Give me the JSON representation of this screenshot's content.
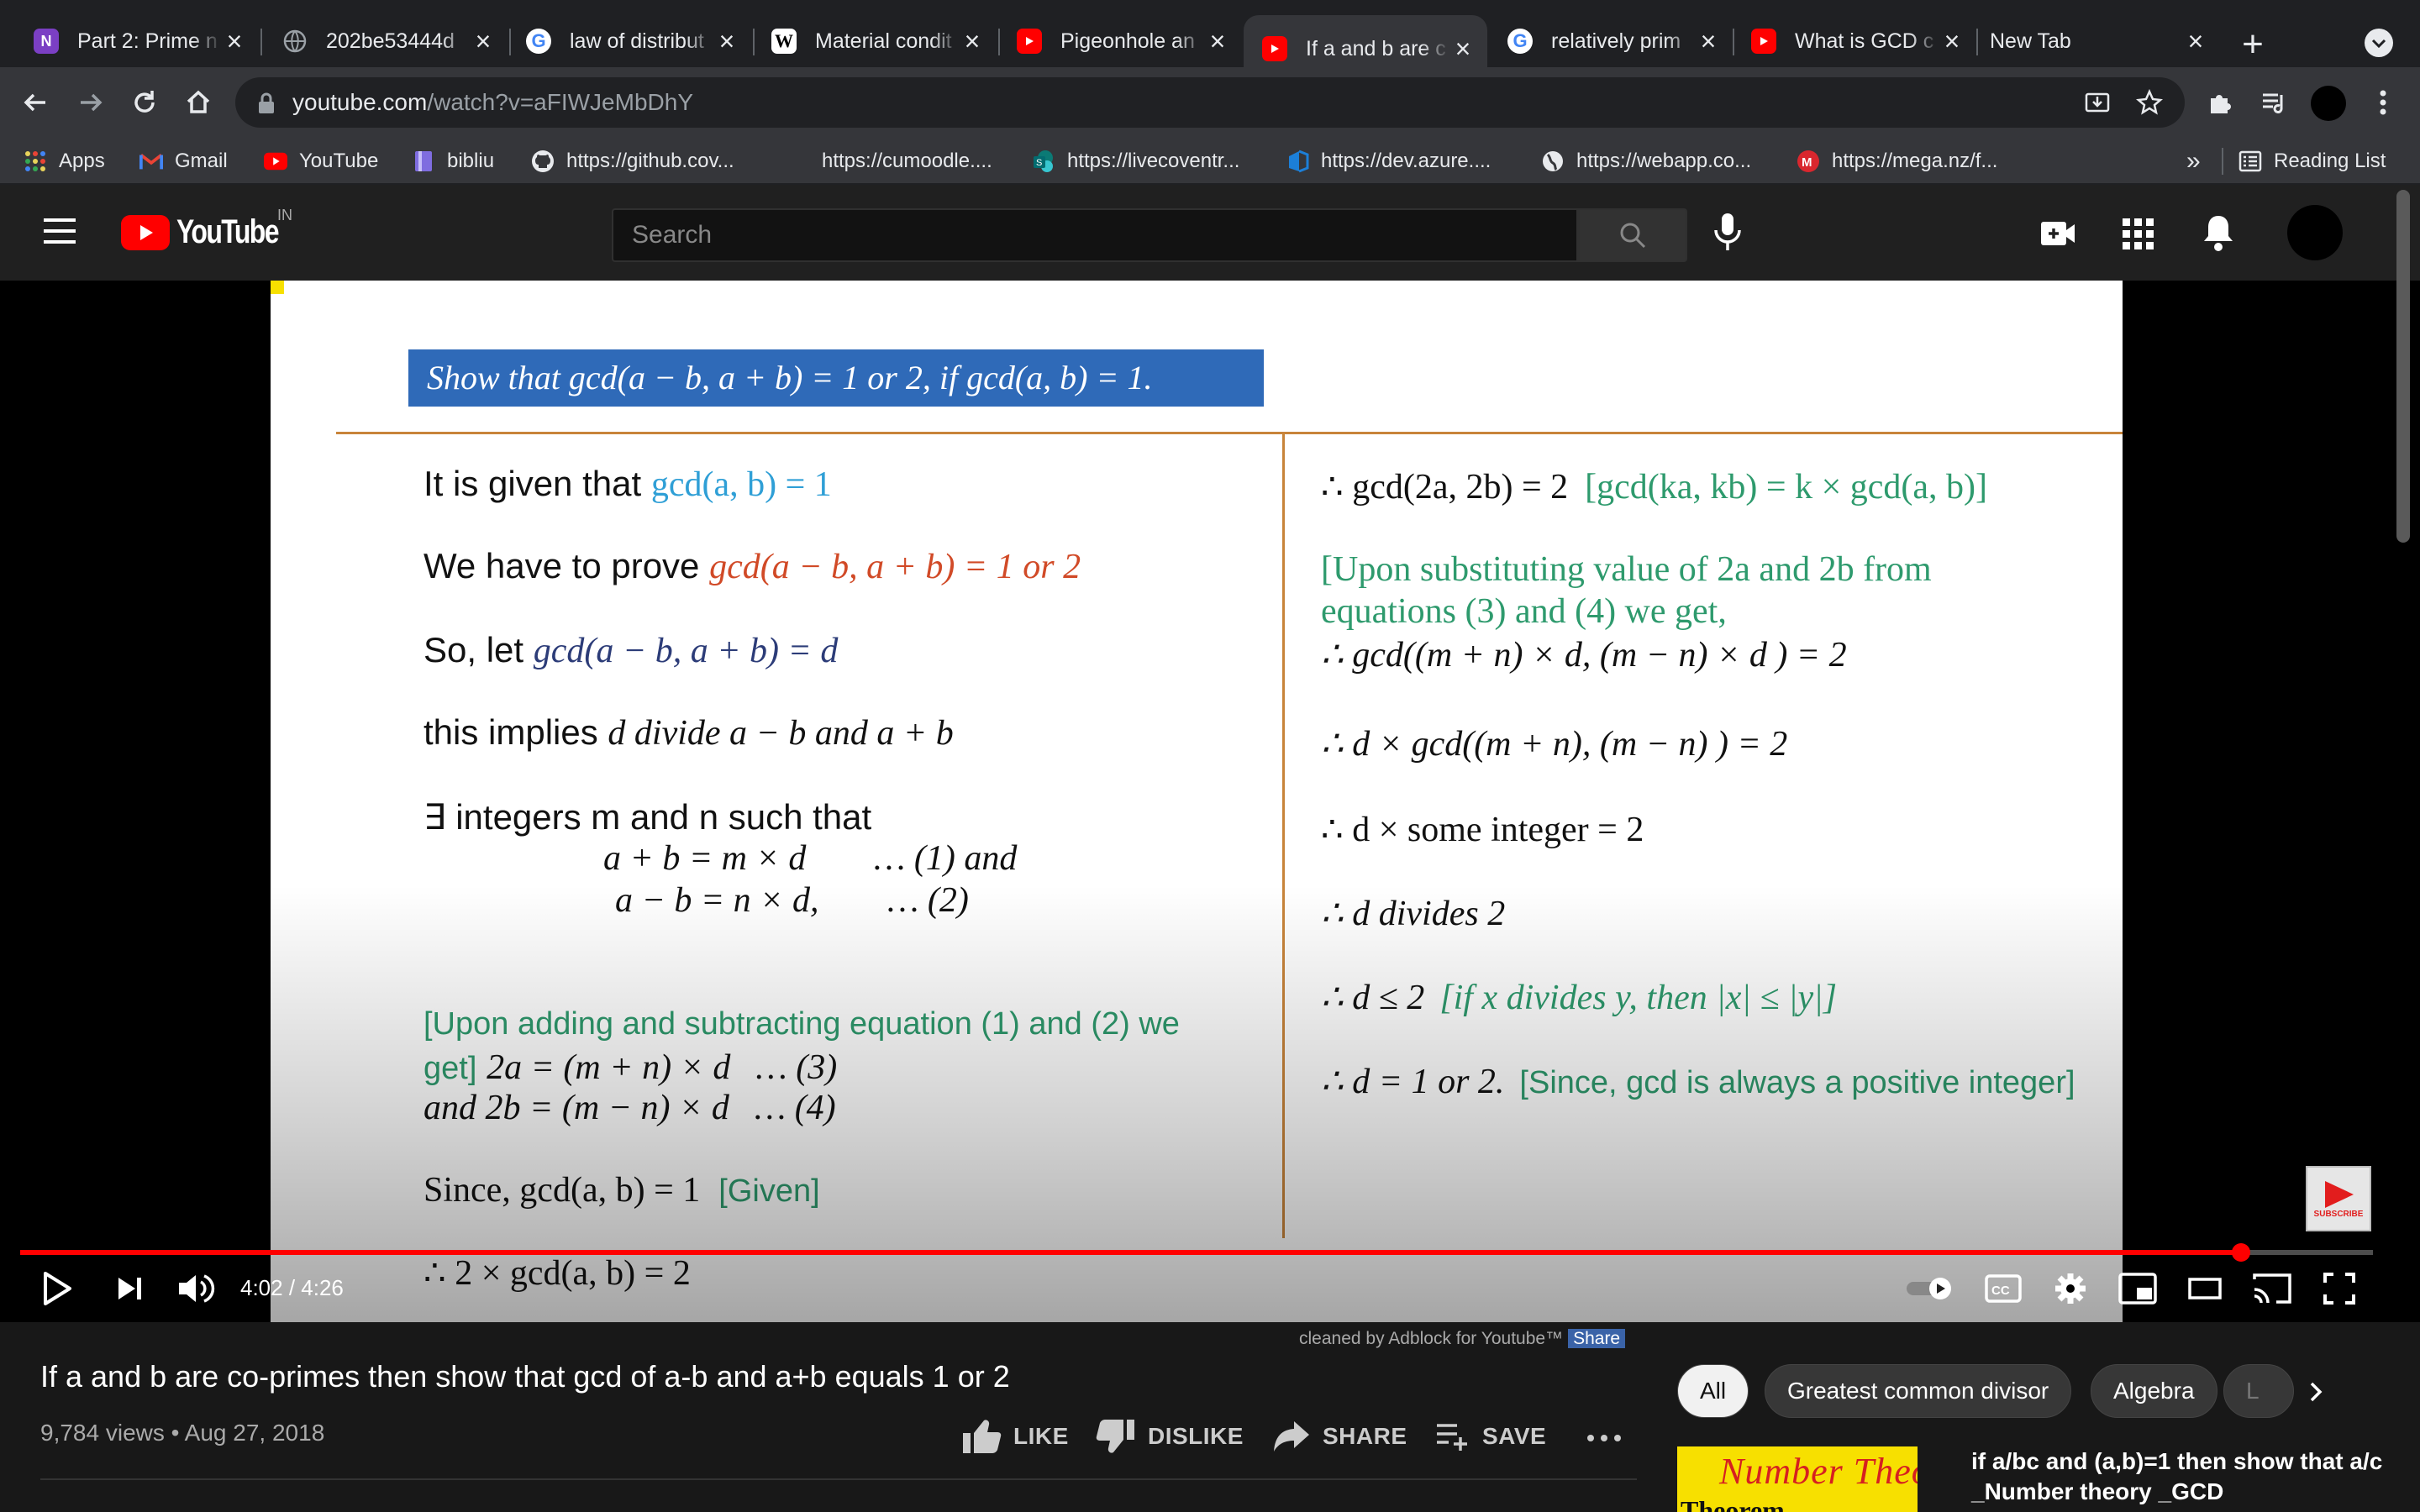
{
  "tabs": [
    {
      "title": "Part 2: Prime n",
      "icon": "onenote-icon",
      "color": "#7b3fc4"
    },
    {
      "title": "202be53444d",
      "icon": "globe-icon",
      "color": "#5f6368"
    },
    {
      "title": "law of distribut",
      "icon": "google-icon",
      "color": "#ffffff"
    },
    {
      "title": "Material condit",
      "icon": "wikipedia-icon",
      "color": "#ffffff"
    },
    {
      "title": "Pigeonhole an",
      "icon": "youtube-icon",
      "color": "#ff0000"
    },
    {
      "title": "If a and b are c",
      "icon": "youtube-icon",
      "color": "#ff0000",
      "active": true
    },
    {
      "title": "relatively prim",
      "icon": "google-icon",
      "color": "#ffffff"
    },
    {
      "title": "What is GCD c",
      "icon": "youtube-icon",
      "color": "#ff0000"
    },
    {
      "title": "New Tab",
      "icon": "",
      "color": ""
    }
  ],
  "url": {
    "host": "youtube.com",
    "path": "/watch?v=aFIWJeMbDhY"
  },
  "bookmarks": [
    {
      "label": "Apps",
      "icon": "apps-grid-icon"
    },
    {
      "label": "Gmail",
      "icon": "gmail-icon"
    },
    {
      "label": "YouTube",
      "icon": "youtube-icon"
    },
    {
      "label": "bibliu",
      "icon": "bibliu-icon"
    },
    {
      "label": "https://github.cov...",
      "icon": "github-icon"
    },
    {
      "label": "https://cumoodle....",
      "icon": ""
    },
    {
      "label": "https://livecoventr...",
      "icon": "sharepoint-icon"
    },
    {
      "label": "https://dev.azure....",
      "icon": "azure-icon"
    },
    {
      "label": "https://webapp.co...",
      "icon": "globe-icon"
    },
    {
      "label": "https://mega.nz/f...",
      "icon": "mega-icon"
    }
  ],
  "bookmarks_overflow": "»",
  "reading_list": "Reading List",
  "youtube": {
    "logo_text": "YouTube",
    "country": "IN",
    "search_placeholder": "Search"
  },
  "slide": {
    "header": "Show that  gcd(a − b, a + b) = 1 or 2, if  gcd(a, b) = 1.",
    "left": {
      "given_prefix": "It is given that ",
      "given_math": "gcd(a, b)  =  1",
      "prove_prefix": "We have to prove ",
      "prove_math": "gcd(a − b, a + b)  =  1 or 2",
      "let_prefix": "So, let ",
      "let_math": "gcd(a − b, a + b)  =  d",
      "implies_prefix": "this implies ",
      "implies_math": "d divide a − b and a + b",
      "exists_line": "∃ integers m and n such that",
      "eq1": "a + b  =  m × d",
      "eq1_tag": "… (1) and",
      "eq2": "a − b  =  n × d,",
      "eq2_tag": "… (2)",
      "upon_adding": "[Upon adding and subtracting equation (1) and (2) we",
      "get_bracket": "get]",
      "eq3": "2a  =  (m + n) × d",
      "eq3_tag": "… (3)",
      "eq4": "and 2b  =  (m − n) × d",
      "eq4_tag": "… (4)",
      "since_prefix": "Since, gcd(a, b)  =  1",
      "since_note": "[Given]",
      "last": "∴ 2 × gcd(a, b)  =  2"
    },
    "right": {
      "r1": "∴ gcd(2a, 2b)  =  2",
      "r1_note": "[gcd(ka, kb)  =  k × gcd(a, b)]",
      "r2_a": "[Upon substituting value of 2a and 2b from",
      "r2_b": "equations (3) and (4) we get,",
      "r3": "∴ gcd((m + n) × d, (m − n) × d )  =  2",
      "r4": "∴ d × gcd((m + n), (m − n) )  =  2",
      "r5": "∴ d × some integer  =  2",
      "r6": "∴ d divides 2",
      "r7": "∴ d ≤ 2",
      "r7_note": "[if x divides y, then |x| ≤ |y|]",
      "r8": "∴ d  =  1 or 2.",
      "r8_note": "[Since, gcd is always a positive integer]"
    }
  },
  "player": {
    "time": "4:02 / 4:26",
    "progress": 0.944,
    "subscribe_badge": "SUBSCRIBE"
  },
  "adblock": {
    "text": "cleaned by Adblock for Youtube™",
    "share": "Share"
  },
  "video": {
    "title": "If a and b are co-primes then show that gcd of a-b and a+b equals 1 or 2",
    "meta": "9,784 views • Aug 27, 2018"
  },
  "actions": {
    "like": "LIKE",
    "dislike": "DISLIKE",
    "share": "SHARE",
    "save": "SAVE"
  },
  "chips": [
    "All",
    "Greatest common divisor",
    "Algebra",
    "L"
  ],
  "recommendation": {
    "thumb_text": "Number Theory",
    "thumb_sub": "Theorem",
    "title": "if a/bc and (a,b)=1 then show that a/c _Number theory _GCD"
  }
}
